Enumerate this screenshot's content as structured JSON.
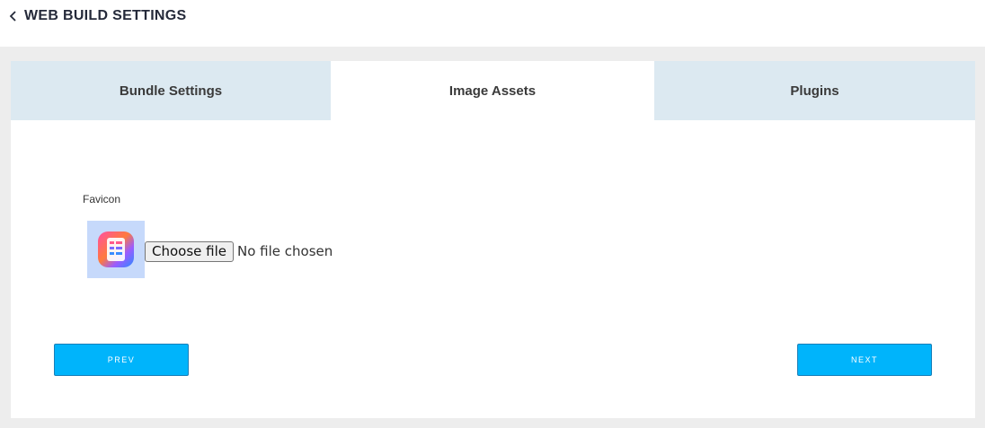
{
  "header": {
    "title": "WEB BUILD SETTINGS",
    "back_icon": "chevron-left-icon"
  },
  "tabs": [
    {
      "label": "Bundle Settings",
      "active": false
    },
    {
      "label": "Image Assets",
      "active": true
    },
    {
      "label": "Plugins",
      "active": false
    }
  ],
  "favicon": {
    "label": "Favicon",
    "choose_label": "Choose file",
    "status": "No file chosen",
    "preview_icon": "app-logo-icon"
  },
  "buttons": {
    "prev": "PREV",
    "next": "NEXT"
  },
  "colors": {
    "accent": "#00b4fb",
    "tab_inactive": "#dce9f1",
    "page_bg": "#ededed"
  }
}
